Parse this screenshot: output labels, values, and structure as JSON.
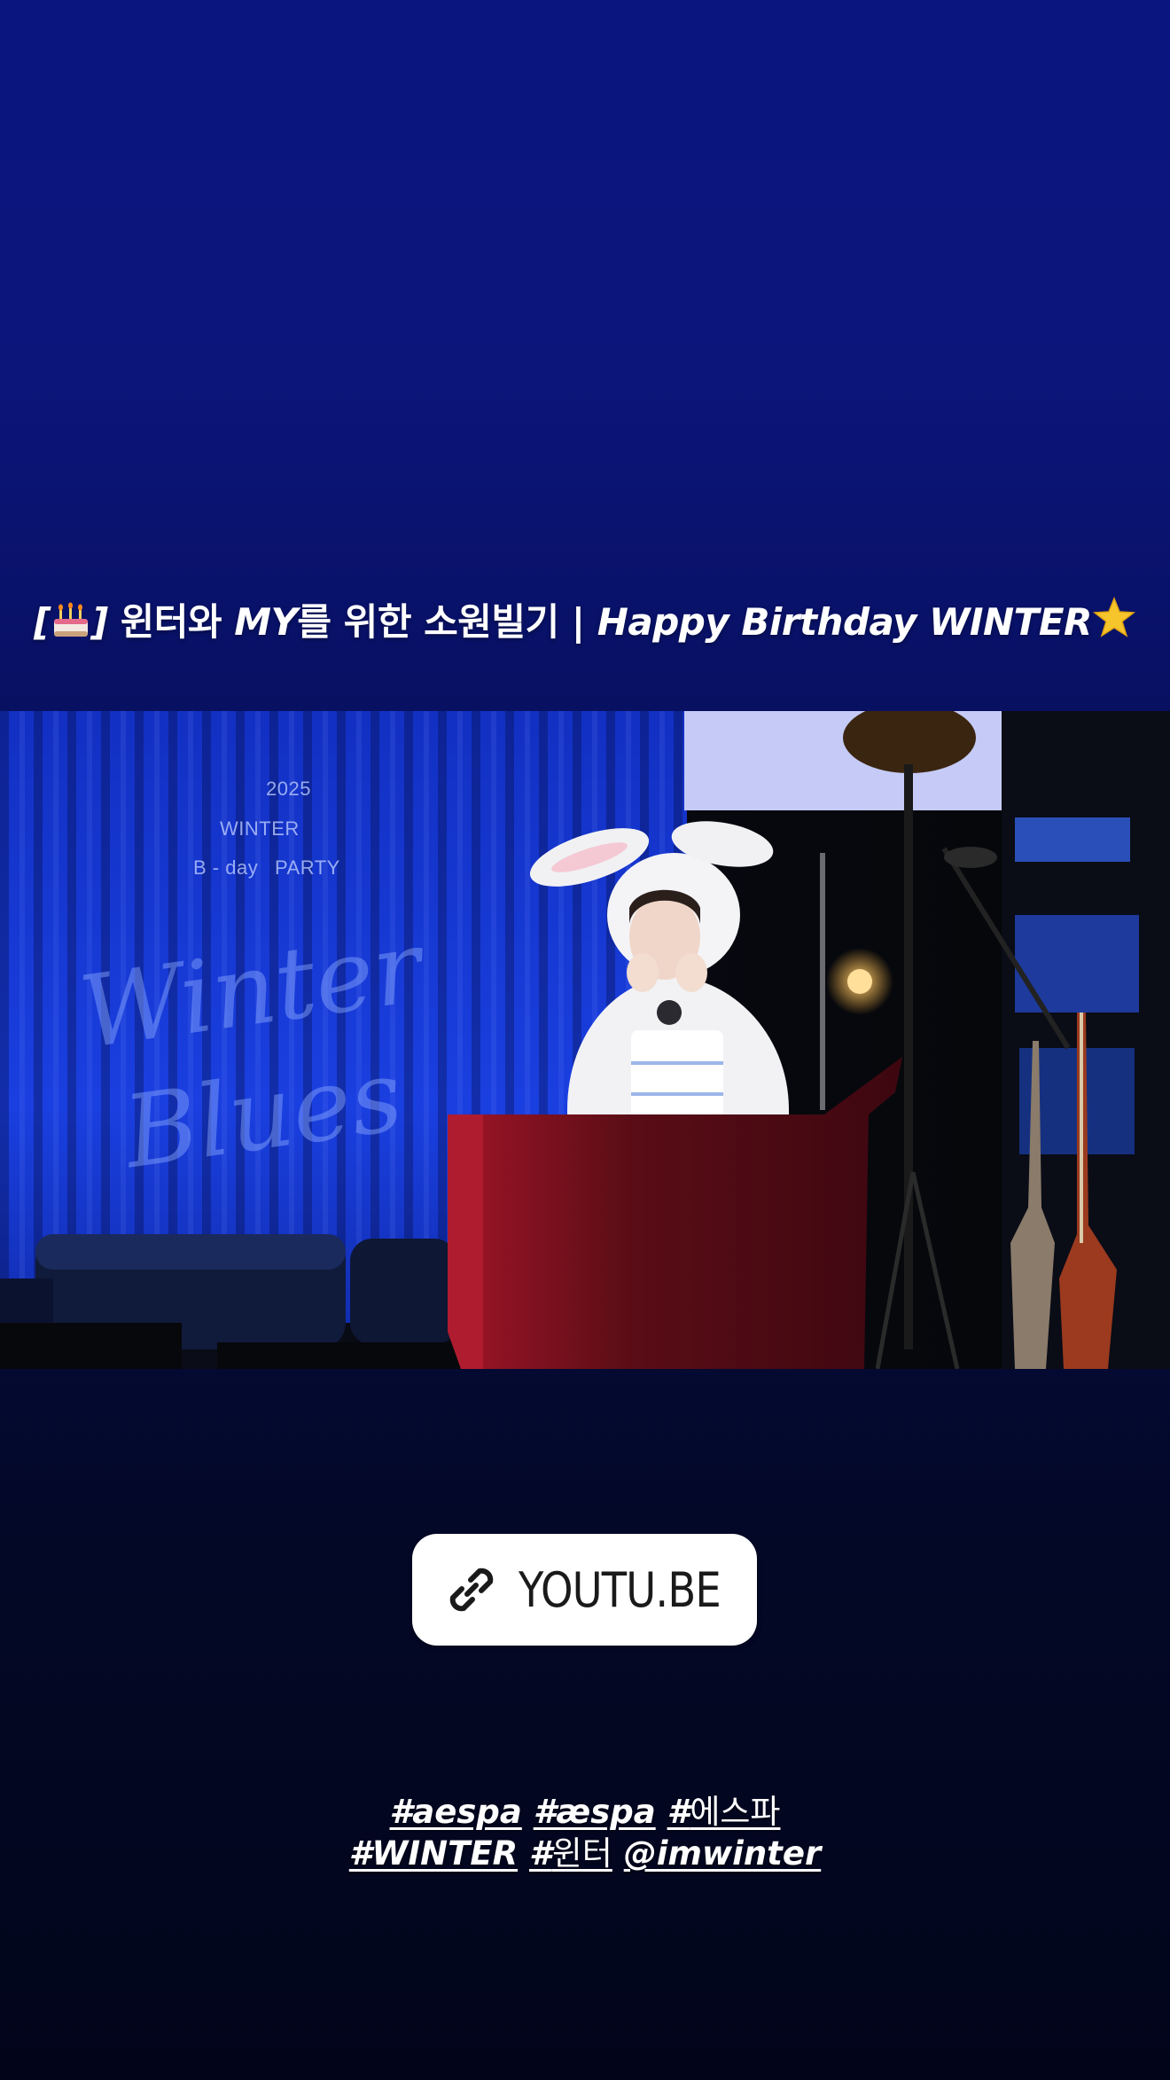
{
  "story": {
    "title": {
      "open_bracket": "[",
      "cake_icon": "birthday-cake-emoji",
      "close_bracket": "]",
      "part1": " 윈터와 ",
      "part2": "MY",
      "part3": "를 위한 소원빌기 | ",
      "part4": "Happy Birthday WINTER",
      "star_icon": "star-emoji"
    },
    "backdrop": {
      "year": "2025",
      "name": "WINTER",
      "bday": "B - day",
      "party": "PARTY",
      "script_line1": "Winter",
      "script_line2": "Blues"
    },
    "link_sticker": {
      "icon": "link-icon",
      "label": "YOUTU.BE"
    },
    "hashtags": {
      "line1": [
        {
          "bold": "#aespa",
          "plain": ""
        },
        {
          "bold": "#æspa",
          "plain": ""
        },
        {
          "bold": "#",
          "plain": "에스파"
        }
      ],
      "line2": [
        {
          "bold": "#WINTER",
          "plain": ""
        },
        {
          "bold": "#",
          "plain": "윈터"
        },
        {
          "bold": "@imwinter",
          "plain": ""
        }
      ]
    },
    "colors": {
      "background_top": "#0a1580",
      "background_bottom": "#02051a",
      "curtain": "#1a3ad6",
      "podium": "#5a0d16"
    }
  }
}
